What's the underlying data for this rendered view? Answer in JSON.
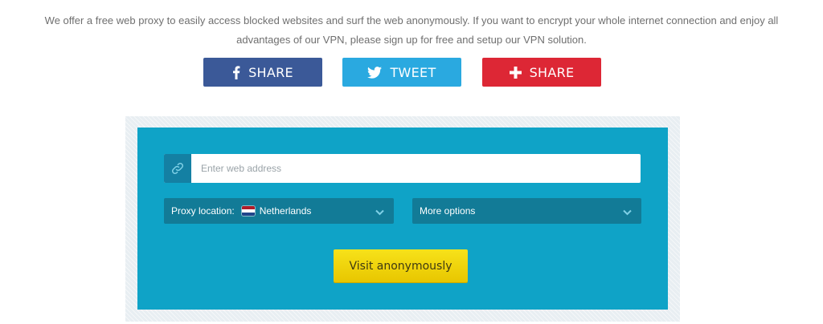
{
  "intro": {
    "line1": "We offer a free web proxy to easily access blocked websites and surf the web anonymously. If you want to encrypt your whole internet connection and enjoy all",
    "line2": "advantages of our VPN, please sign up for free and setup our VPN solution."
  },
  "share_buttons": [
    {
      "label": "SHARE",
      "icon": "facebook-icon",
      "color": "#3b5998"
    },
    {
      "label": "TWEET",
      "icon": "twitter-icon",
      "color": "#2aa9e0"
    },
    {
      "label": "SHARE",
      "icon": "plus-icon",
      "color": "#dd2735"
    }
  ],
  "proxy_form": {
    "url_placeholder": "Enter web address",
    "url_value": "",
    "location_label": "Proxy location:",
    "location_value": "Netherlands",
    "more_options_label": "More options",
    "submit_label": "Visit anonymously"
  },
  "colors": {
    "panel": "#0fa3c7",
    "select_bg": "#127b97",
    "submit": "#f2d60e"
  }
}
